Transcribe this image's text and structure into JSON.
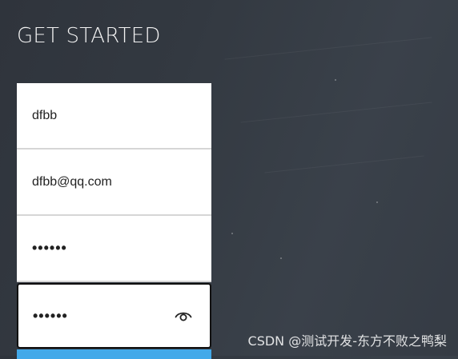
{
  "page": {
    "title": "GET STARTED"
  },
  "form": {
    "name_value": "dfbb",
    "email_value": "dfbb@qq.com",
    "password_value": "••••••",
    "confirm_password_value": "••••••",
    "toggle_visibility_icon": "eye-icon"
  },
  "colors": {
    "background": "#343a42",
    "field_background": "#ffffff",
    "submit_button": "#42a9e9"
  },
  "watermark": {
    "text": "CSDN @测试开发-东方不败之鸭梨"
  }
}
